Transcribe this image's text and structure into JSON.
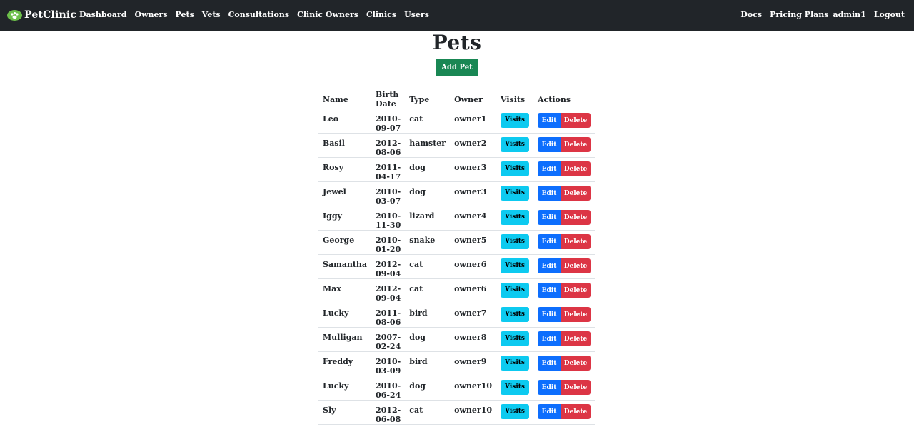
{
  "brand": {
    "name": "PetClinic",
    "logo_color": "#6cbf4a"
  },
  "nav": {
    "left": [
      "Dashboard",
      "Owners",
      "Pets",
      "Vets",
      "Consultations",
      "Clinic Owners",
      "Clinics",
      "Users"
    ],
    "right": [
      "Docs",
      "Pricing Plans",
      "admin1",
      "Logout"
    ]
  },
  "page": {
    "title": "Pets",
    "add_button": "Add Pet"
  },
  "table": {
    "headers": [
      "Name",
      "Birth Date",
      "Type",
      "Owner",
      "Visits",
      "Actions"
    ],
    "visits_label": "Visits",
    "edit_label": "Edit",
    "delete_label": "Delete",
    "rows": [
      {
        "name": "Leo",
        "birth": "2010-09-07",
        "type": "cat",
        "owner": "owner1"
      },
      {
        "name": "Basil",
        "birth": "2012-08-06",
        "type": "hamster",
        "owner": "owner2"
      },
      {
        "name": "Rosy",
        "birth": "2011-04-17",
        "type": "dog",
        "owner": "owner3"
      },
      {
        "name": "Jewel",
        "birth": "2010-03-07",
        "type": "dog",
        "owner": "owner3"
      },
      {
        "name": "Iggy",
        "birth": "2010-11-30",
        "type": "lizard",
        "owner": "owner4"
      },
      {
        "name": "George",
        "birth": "2010-01-20",
        "type": "snake",
        "owner": "owner5"
      },
      {
        "name": "Samantha",
        "birth": "2012-09-04",
        "type": "cat",
        "owner": "owner6"
      },
      {
        "name": "Max",
        "birth": "2012-09-04",
        "type": "cat",
        "owner": "owner6"
      },
      {
        "name": "Lucky",
        "birth": "2011-08-06",
        "type": "bird",
        "owner": "owner7"
      },
      {
        "name": "Mulligan",
        "birth": "2007-02-24",
        "type": "dog",
        "owner": "owner8"
      },
      {
        "name": "Freddy",
        "birth": "2010-03-09",
        "type": "bird",
        "owner": "owner9"
      },
      {
        "name": "Lucky",
        "birth": "2010-06-24",
        "type": "dog",
        "owner": "owner10"
      },
      {
        "name": "Sly",
        "birth": "2012-06-08",
        "type": "cat",
        "owner": "owner10"
      }
    ]
  },
  "colors": {
    "navbar": "#212529",
    "add": "#198754",
    "visits": "#0dcaf0",
    "edit": "#0d6efd",
    "delete": "#dc3545"
  }
}
